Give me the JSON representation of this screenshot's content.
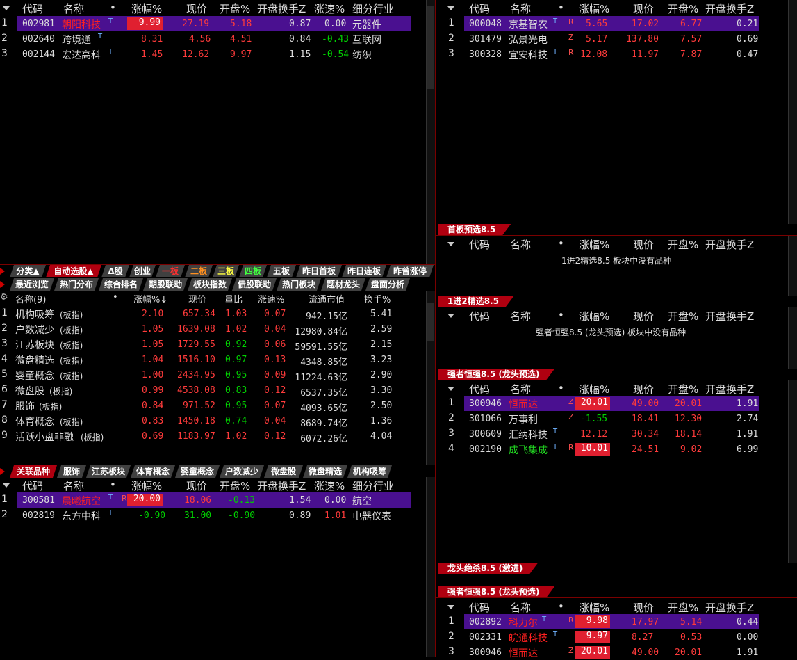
{
  "cols_main": [
    "代码",
    "名称",
    "•",
    "涨幅%",
    "现价",
    "开盘%",
    "开盘换手Z",
    "涨速%",
    "细分行业"
  ],
  "cols_right": [
    "代码",
    "名称",
    "•",
    "涨幅%",
    "现价",
    "开盘%",
    "开盘换手Z"
  ],
  "top_left": {
    "rows": [
      {
        "idx": "1",
        "code": "002981",
        "name": "朝阳科技",
        "sup": "T",
        "pct": "9.99",
        "price": "27.19",
        "open": "5.18",
        "turn": "0.87",
        "speed": "0.00",
        "ind": "元器件"
      },
      {
        "idx": "2",
        "code": "002640",
        "name": "跨境通",
        "sup": "T",
        "pct": "8.31",
        "price": "4.56",
        "open": "4.51",
        "turn": "0.84",
        "speed": "-0.43",
        "ind": "互联网"
      },
      {
        "idx": "3",
        "code": "002144",
        "name": "宏达高科",
        "sup": "T",
        "pct": "1.45",
        "price": "12.62",
        "open": "9.97",
        "turn": "1.15",
        "speed": "-0.54",
        "ind": "纺织"
      }
    ]
  },
  "top_right": {
    "rows": [
      {
        "idx": "1",
        "code": "000048",
        "name": "京基智农",
        "sup": "T",
        "tag": "R",
        "pct": "5.65",
        "price": "17.02",
        "open": "6.77",
        "turn": "0.21"
      },
      {
        "idx": "2",
        "code": "301479",
        "name": "弘景光电",
        "sup": "",
        "tag": "Z",
        "pct": "5.17",
        "price": "137.80",
        "open": "7.57",
        "turn": "0.69"
      },
      {
        "idx": "3",
        "code": "300328",
        "name": "宜安科技",
        "sup": "T",
        "tag": "R",
        "pct": "12.08",
        "price": "11.97",
        "open": "7.87",
        "turn": "0.47"
      }
    ]
  },
  "tabs_row1": [
    "分类▲",
    "自动选股▲",
    "Δ股",
    "创业",
    "一板",
    "二板",
    "三板",
    "四板",
    "五板",
    "昨日首板",
    "昨日连板",
    "昨曾涨停"
  ],
  "tabs_row2": [
    "最近浏览",
    "热门分布",
    "综合排名",
    "期股联动",
    "板块指数",
    "债股联动",
    "热门板块",
    "题材龙头",
    "盘面分析"
  ],
  "sector": {
    "cols": [
      "名称(9)",
      "•",
      "涨幅%↓",
      "现价",
      "量比",
      "涨速%",
      "流通市值",
      "换手%"
    ],
    "rows": [
      {
        "idx": "1",
        "name": "机构吸筹",
        "sub": "(板指)",
        "pct": "2.10",
        "price": "657.34",
        "vr": "1.03",
        "speed": "0.07",
        "cap": "942.15亿",
        "turn": "5.41"
      },
      {
        "idx": "2",
        "name": "户数减少",
        "sub": "(板指)",
        "pct": "1.05",
        "price": "1639.08",
        "vr": "1.02",
        "speed": "0.04",
        "cap": "12980.84亿",
        "turn": "2.59"
      },
      {
        "idx": "3",
        "name": "江苏板块",
        "sub": "(板指)",
        "pct": "1.05",
        "price": "1729.55",
        "vr": "0.92",
        "speed": "0.06",
        "cap": "59591.55亿",
        "turn": "2.15"
      },
      {
        "idx": "4",
        "name": "微盘精选",
        "sub": "(板指)",
        "pct": "1.04",
        "price": "1516.10",
        "vr": "0.97",
        "speed": "0.13",
        "cap": "4348.85亿",
        "turn": "3.23"
      },
      {
        "idx": "5",
        "name": "婴童概念",
        "sub": "(板指)",
        "pct": "1.00",
        "price": "2434.95",
        "vr": "0.95",
        "speed": "0.09",
        "cap": "11224.63亿",
        "turn": "2.90"
      },
      {
        "idx": "6",
        "name": "微盘股",
        "sub": "(板指)",
        "pct": "0.99",
        "price": "4538.08",
        "vr": "0.83",
        "speed": "0.12",
        "cap": "6537.35亿",
        "turn": "3.30"
      },
      {
        "idx": "7",
        "name": "服饰",
        "sub": "(板指)",
        "pct": "0.84",
        "price": "971.52",
        "vr": "0.95",
        "speed": "0.07",
        "cap": "4093.65亿",
        "turn": "2.50"
      },
      {
        "idx": "8",
        "name": "体育概念",
        "sub": "(板指)",
        "pct": "0.83",
        "price": "1450.18",
        "vr": "0.74",
        "speed": "0.04",
        "cap": "8689.74亿",
        "turn": "1.36"
      },
      {
        "idx": "9",
        "name": "活跃小盘非融",
        "sub": "(板指)",
        "pct": "0.69",
        "price": "1183.97",
        "vr": "1.02",
        "speed": "0.12",
        "cap": "6072.26亿",
        "turn": "4.04"
      }
    ]
  },
  "tabs_related": [
    "关联品种",
    "服饰",
    "江苏板块",
    "体育概念",
    "婴童概念",
    "户数减少",
    "微盘股",
    "微盘精选",
    "机构吸筹"
  ],
  "related": {
    "rows": [
      {
        "idx": "1",
        "code": "300581",
        "name": "晨曦航空",
        "sup": "T",
        "tag": "R",
        "pct": "20.00",
        "price": "18.06",
        "open": "-0.13",
        "turn": "1.54",
        "speed": "0.00",
        "ind": "航空"
      },
      {
        "idx": "2",
        "code": "002819",
        "name": "东方中科",
        "sup": "T",
        "tag": "",
        "pct": "-0.90",
        "price": "31.00",
        "open": "-0.90",
        "turn": "0.89",
        "speed": "1.01",
        "ind": "电器仪表"
      }
    ]
  },
  "panel_first": {
    "title": "首板预选8.5",
    "empty": "1进2精选8.5 板块中没有品种"
  },
  "panel_second": {
    "title": "1进2精选8.5",
    "empty": "强者恒强8.5 (龙头预选) 板块中没有品种"
  },
  "panel_strong": {
    "title": "强者恒强8.5 (龙头预选)",
    "rows": [
      {
        "idx": "1",
        "code": "300946",
        "name": "恒而达",
        "sup": "",
        "tag": "Z",
        "pct": "20.01",
        "price": "49.00",
        "open": "20.01",
        "turn": "1.91"
      },
      {
        "idx": "2",
        "code": "301066",
        "name": "万事利",
        "sup": "",
        "tag": "Z",
        "pct": "-1.55",
        "price": "18.41",
        "open": "12.30",
        "turn": "2.74"
      },
      {
        "idx": "3",
        "code": "300609",
        "name": "汇纳科技",
        "sup": "T",
        "tag": "",
        "pct": "12.12",
        "price": "30.34",
        "open": "18.14",
        "turn": "1.91"
      },
      {
        "idx": "4",
        "code": "002190",
        "name": "成飞集成",
        "sup": "T",
        "tag": "R",
        "pct": "10.01",
        "price": "24.51",
        "open": "9.02",
        "turn": "6.99"
      }
    ]
  },
  "panel_kill": {
    "title": "龙头绝杀8.5 (激进)"
  },
  "panel_strong2": {
    "title": "强者恒强8.5 (龙头预选)",
    "rows": [
      {
        "idx": "1",
        "code": "002892",
        "name": "科力尔",
        "sup": "T",
        "tag": "R",
        "pct": "9.98",
        "price": "17.97",
        "open": "5.14",
        "turn": "0.44"
      },
      {
        "idx": "2",
        "code": "002331",
        "name": "皖通科技",
        "sup": "T",
        "tag": "",
        "pct": "9.97",
        "price": "8.27",
        "open": "0.53",
        "turn": "0.00"
      },
      {
        "idx": "3",
        "code": "300946",
        "name": "恒而达",
        "sup": "",
        "tag": "Z",
        "pct": "20.01",
        "price": "49.00",
        "open": "20.01",
        "turn": "1.91"
      }
    ]
  }
}
